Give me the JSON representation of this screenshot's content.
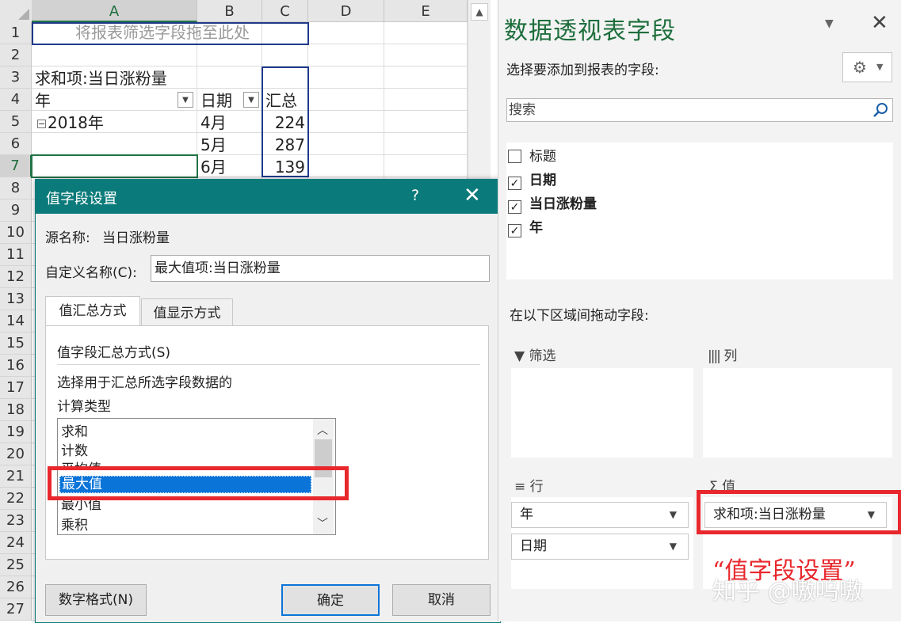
{
  "spreadsheet": {
    "columns": [
      "A",
      "B",
      "C",
      "D",
      "E"
    ],
    "rows": [
      "1",
      "2",
      "3",
      "4",
      "5",
      "6",
      "7",
      "8",
      "9",
      "10",
      "11",
      "12",
      "13",
      "14",
      "15",
      "16",
      "17",
      "18",
      "19",
      "20",
      "21",
      "22",
      "23",
      "24",
      "25",
      "26",
      "27"
    ],
    "filter_hint": "将报表筛选字段拖至此处",
    "value_title": "求和项:当日涨粉量",
    "row_label": "年",
    "col_label": "日期",
    "total_label": "汇总",
    "year": "2018年",
    "months": [
      "4月",
      "5月",
      "6月"
    ],
    "values": [
      "224",
      "287",
      "139"
    ]
  },
  "dialog": {
    "title": "值字段设置",
    "help": "?",
    "source_name_label": "源名称:",
    "source_name_value": "当日涨粉量",
    "custom_name_label": "自定义名称(C):",
    "custom_name_value": "最大值项:当日涨粉量",
    "tabs": [
      "值汇总方式",
      "值显示方式"
    ],
    "summary_section": "值字段汇总方式(S)",
    "desc_line1": "选择用于汇总所选字段数据的",
    "desc_line2": "计算类型",
    "list_items": [
      "求和",
      "计数",
      "平均值",
      "最大值",
      "最小值",
      "乘积"
    ],
    "selected_item": "最大值",
    "number_format_button": "数字格式(N)",
    "ok_button": "确定",
    "cancel_button": "取消"
  },
  "pane": {
    "title": "数据透视表字段",
    "choose_label": "选择要添加到报表的字段:",
    "search_placeholder": "搜索",
    "fields": [
      {
        "label": "标题",
        "checked": false
      },
      {
        "label": "日期",
        "checked": true
      },
      {
        "label": "当日涨粉量",
        "checked": true
      },
      {
        "label": "年",
        "checked": true
      }
    ],
    "drag_label": "在以下区域间拖动字段:",
    "filter_area": "筛选",
    "column_area": "列",
    "row_area": "行",
    "value_area": "值",
    "row_items": [
      "年",
      "日期"
    ],
    "value_item": "求和项:当日涨粉量",
    "annotation": "“值字段设置”",
    "watermark": "知乎 @嗷呜嗷"
  },
  "colors": {
    "accent_teal": "#0b7a7a",
    "excel_green": "#217346",
    "highlight_red": "#e8282d",
    "selection_blue": "#0a74d9"
  }
}
